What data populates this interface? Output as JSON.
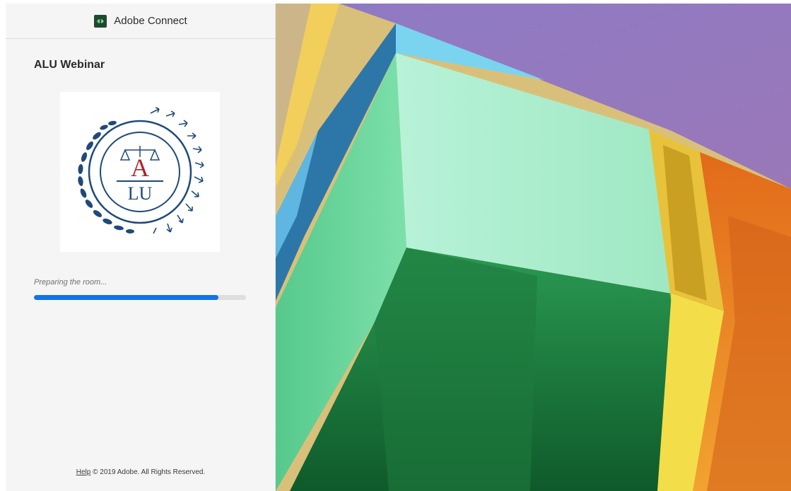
{
  "header": {
    "app_title": "Adobe Connect",
    "app_icon": "adobe-connect-icon"
  },
  "room": {
    "title": "ALU Webinar",
    "logo": {
      "icon": "alu-laurel-logo",
      "letters_top": "A",
      "letters_bottom": "LU",
      "navy": "#1e4a7a",
      "red": "#b0242a"
    }
  },
  "status": {
    "message": "Preparing the room...",
    "progress": 0.87
  },
  "footer": {
    "help_label": "Help",
    "copyright": "© 2019 Adobe. All Rights Reserved."
  },
  "colors": {
    "accent": "#1473e6",
    "panel_bg": "#f5f5f5"
  }
}
